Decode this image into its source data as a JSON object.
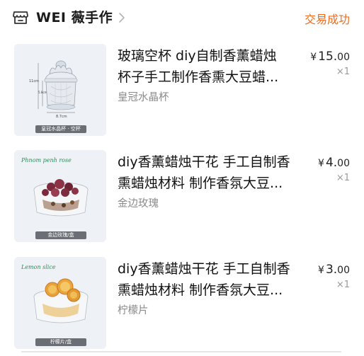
{
  "header": {
    "store_name": "WEI 薇手作",
    "order_status": "交易成功"
  },
  "items": [
    {
      "title_line1": "玻璃空杯 diy自制香薰蜡烛",
      "title_line2": "杯子手工制作香熏大豆蜡...",
      "variant": "皇冠水晶杯",
      "price_currency": "¥",
      "price_int": "15.",
      "price_dec": "00",
      "quantity": "×1",
      "image": {
        "caption": "皇冠水晶杯 · 空杯",
        "height_label": "11cm",
        "mid_label": "5.8cm",
        "width_label": "8.7cm"
      }
    },
    {
      "title_line1": "diy香薰蜡烛干花 手工自制香",
      "title_line2": "熏蜡烛材料 制作香氛大豆...",
      "variant": "金边玫瑰",
      "price_currency": "¥",
      "price_int": "4.",
      "price_dec": "00",
      "quantity": "×1",
      "image": {
        "tag": "Phnom penh rose",
        "caption": "金边玫瑰/盒"
      }
    },
    {
      "title_line1": "diy香薰蜡烛干花 手工自制香",
      "title_line2": "熏蜡烛材料 制作香氛大豆...",
      "variant": "柠檬片",
      "price_currency": "¥",
      "price_int": "3.",
      "price_dec": "00",
      "quantity": "×1",
      "image": {
        "tag": "Lemon slice",
        "caption": "柠檬片/盒"
      }
    }
  ],
  "colors": {
    "status_orange": "#f26b1d",
    "thumb_bg": "#eef1f5",
    "muted_text": "#8a8a8a"
  },
  "icons": {
    "store": "store-icon",
    "chevron": "chevron-right-icon"
  }
}
